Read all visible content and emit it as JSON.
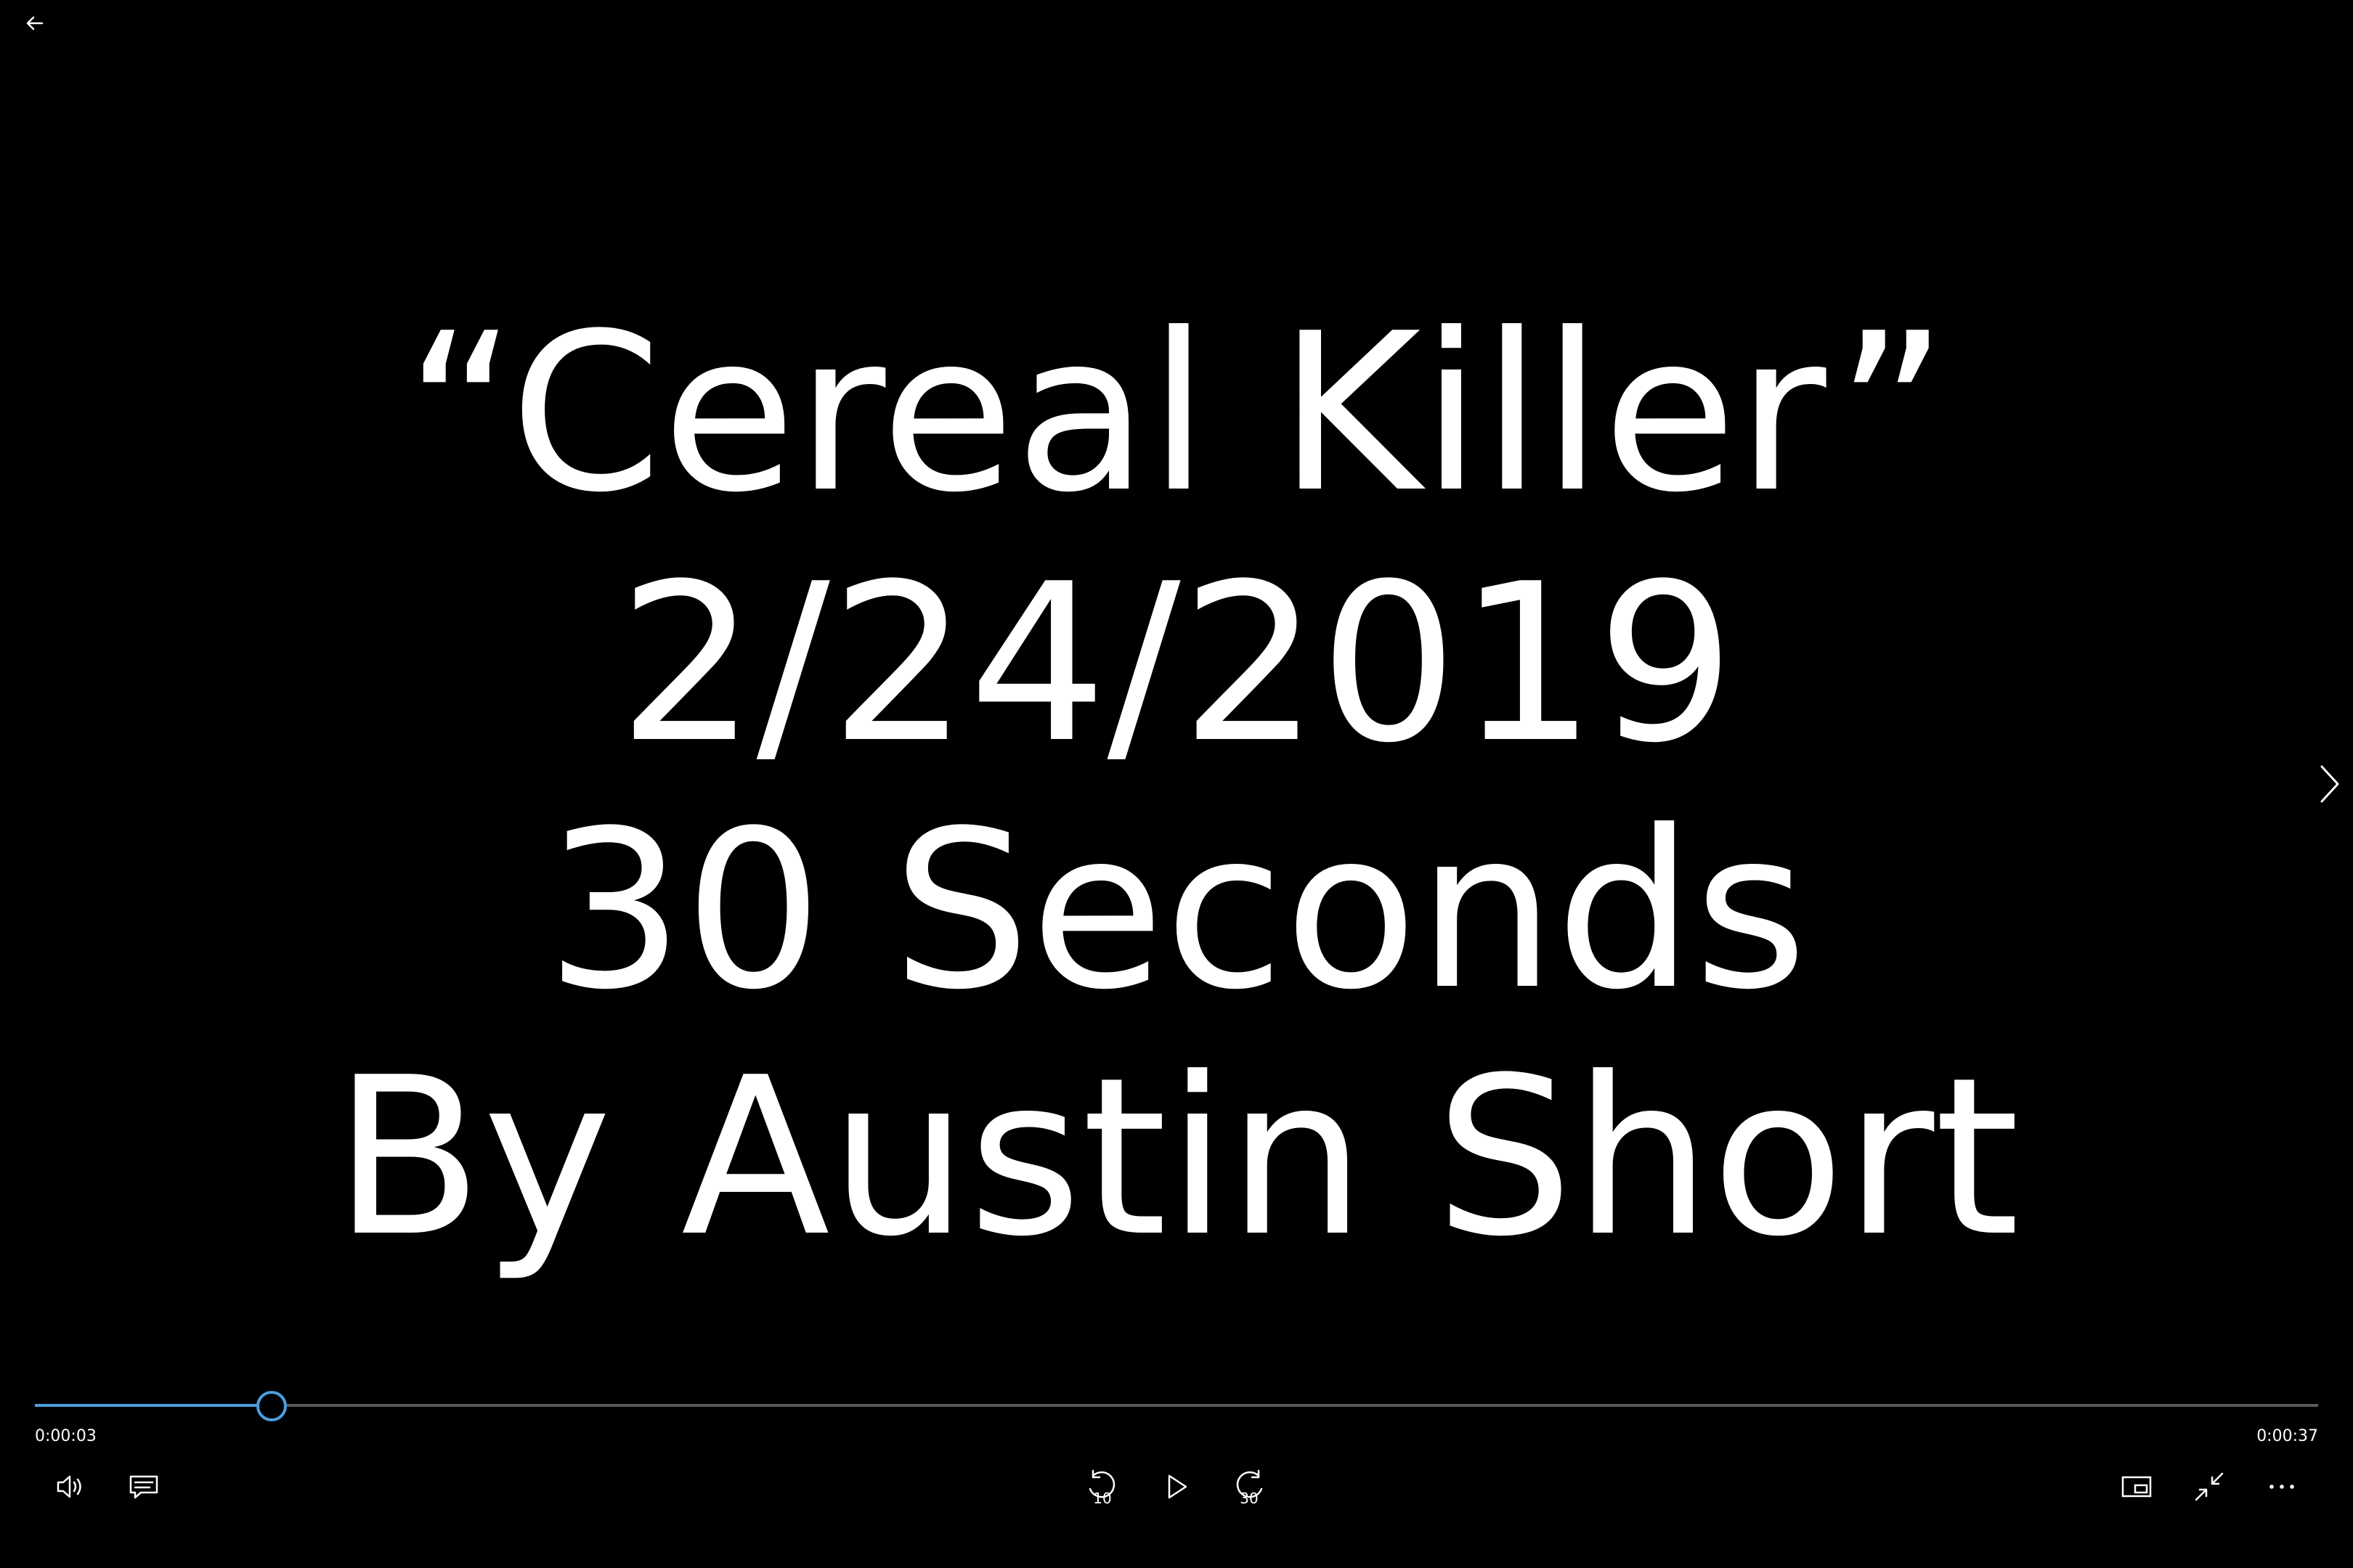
{
  "video": {
    "title_lines": [
      "“Cereal Killer”",
      "2/24/2019",
      "30 Seconds",
      "By Austin Short"
    ]
  },
  "playback": {
    "current_time": "0:00:03",
    "total_time": "0:00:37",
    "progress_fraction": 0.1027,
    "accent_color": "#4a9ee0"
  },
  "controls": {
    "skip_back_seconds": "10",
    "skip_forward_seconds": "30",
    "icons": {
      "back": "arrow-left-icon",
      "next": "chevron-right-icon",
      "volume": "volume-icon",
      "captions": "captions-icon",
      "skip_back": "skip-back-10-icon",
      "play": "play-icon",
      "skip_forward": "skip-forward-30-icon",
      "mini_view": "mini-view-icon",
      "exit_fullscreen": "exit-fullscreen-icon",
      "more": "more-options-icon"
    }
  }
}
